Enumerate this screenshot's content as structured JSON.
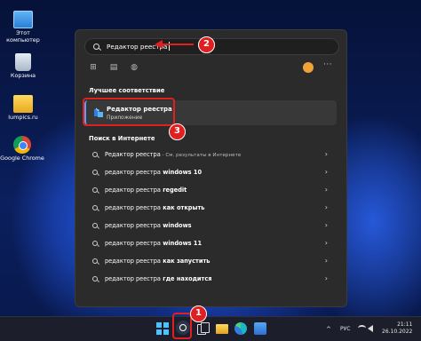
{
  "desktop": {
    "icons": [
      {
        "label": "Этот компьютер",
        "icon": "this-pc-icon"
      },
      {
        "label": "Корзина",
        "icon": "recycle-bin-icon"
      },
      {
        "label": "lumpics.ru",
        "icon": "folder-icon"
      },
      {
        "label": "Google Chrome",
        "icon": "chrome-icon"
      }
    ]
  },
  "search": {
    "query": "Редактор реестра",
    "icon": "search-icon"
  },
  "toolbar": {
    "icons": [
      "apps-icon",
      "document-icon",
      "globe-icon"
    ],
    "more": "···"
  },
  "best_match": {
    "heading": "Лучшее соответствие",
    "title": "Редактор реестра",
    "subtitle": "Приложение",
    "icon": "registry-editor-icon"
  },
  "web": {
    "heading": "Поиск в Интернете",
    "first": {
      "query": "Редактор реестра",
      "hint": " - См. результаты в Интернете"
    },
    "items": [
      {
        "base": "редактор реестра",
        "bold": " windows 10"
      },
      {
        "base": "редактор реестра",
        "bold": " regedit"
      },
      {
        "base": "редактор реестра",
        "bold": " как открыть"
      },
      {
        "base": "редактор реестра",
        "bold": " windows"
      },
      {
        "base": "редактор реестра",
        "bold": " windows 11"
      },
      {
        "base": "редактор реестра",
        "bold": " как запустить"
      },
      {
        "base": "редактор реестра",
        "bold": " где находится"
      }
    ]
  },
  "taskbar": {
    "items": [
      "start-icon",
      "search-icon",
      "task-view-icon",
      "file-explorer-icon",
      "edge-icon",
      "store-icon"
    ],
    "tray": {
      "chevron": "^",
      "lang": "РУС",
      "time": "21:11",
      "date": "26.10.2022"
    }
  },
  "annotations": {
    "step1": "1",
    "step2": "2",
    "step3": "3",
    "color": "#e02020"
  }
}
